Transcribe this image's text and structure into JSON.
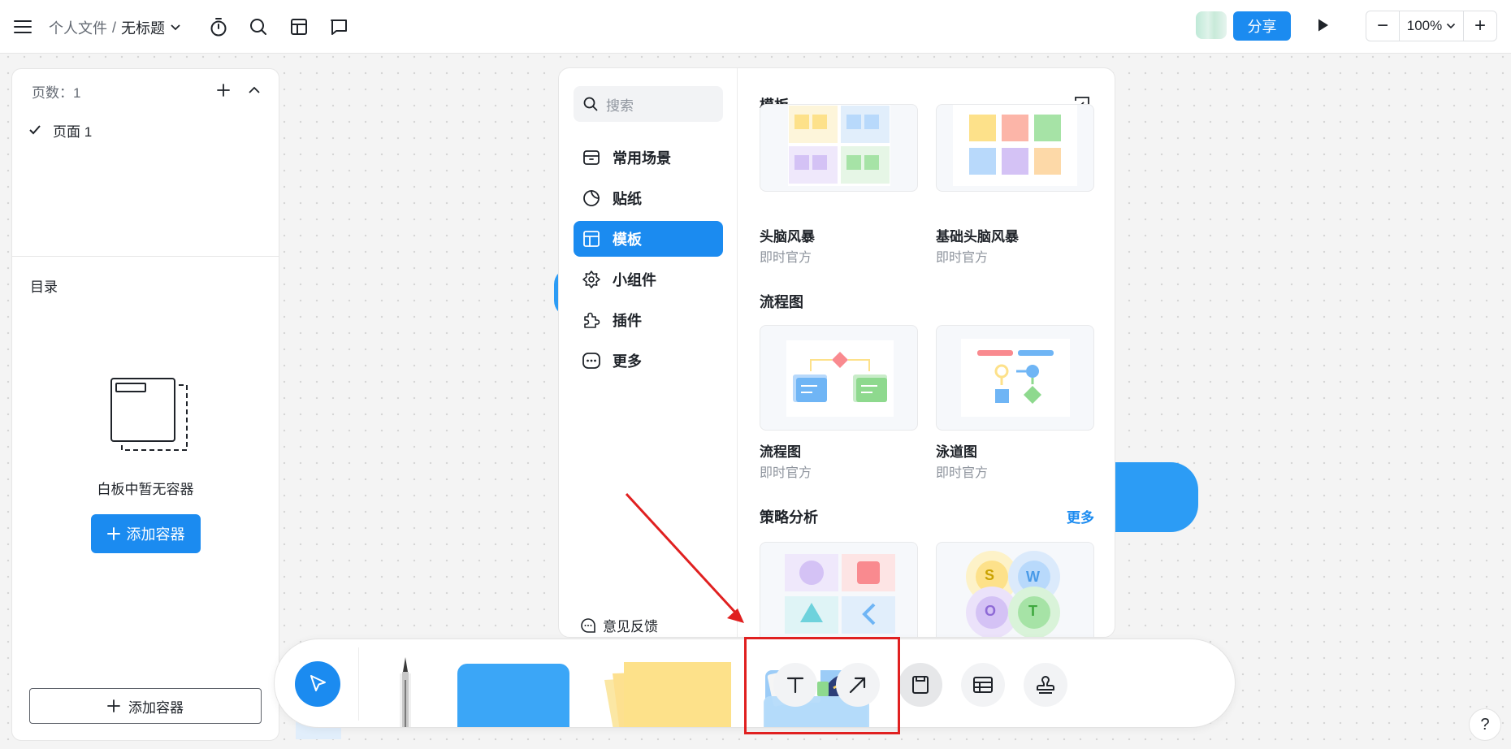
{
  "topbar": {
    "breadcrumb_parent": "个人文件",
    "breadcrumb_sep": "/",
    "breadcrumb_current": "无标题",
    "share_label": "分享",
    "zoom_value": "100%",
    "zoom_minus": "−",
    "zoom_plus": "+"
  },
  "left_panel": {
    "pages_label": "页数：1",
    "pages": [
      {
        "label": "页面 1",
        "selected": true
      }
    ],
    "toc_title": "目录",
    "empty_text": "白板中暂无容器",
    "add_container_primary": "添加容器",
    "add_container_outline": "添加容器"
  },
  "resource_panel": {
    "search_placeholder": "搜索",
    "nav": [
      {
        "label": "常用场景",
        "icon": "box-icon",
        "active": false
      },
      {
        "label": "贴纸",
        "icon": "sticker-icon",
        "active": false
      },
      {
        "label": "模板",
        "icon": "template-icon",
        "active": true
      },
      {
        "label": "小组件",
        "icon": "widget-icon",
        "active": false
      },
      {
        "label": "插件",
        "icon": "plugin-icon",
        "active": false
      },
      {
        "label": "更多",
        "icon": "more-icon",
        "active": false
      }
    ],
    "feedback_label": "意见反馈",
    "main_title": "模板",
    "sections": [
      {
        "title": "",
        "cards": [
          {
            "name": "头脑风暴",
            "source": "即时官方"
          },
          {
            "name": "基础头脑风暴",
            "source": "即时官方"
          }
        ]
      },
      {
        "title": "流程图",
        "cards": [
          {
            "name": "流程图",
            "source": "即时官方"
          },
          {
            "name": "泳道图",
            "source": "即时官方"
          }
        ]
      },
      {
        "title": "策略分析",
        "more_label": "更多",
        "cards": [
          {
            "name": "",
            "source": ""
          },
          {
            "name": "",
            "source": ""
          }
        ]
      }
    ],
    "swot_letters": [
      "S",
      "W",
      "O",
      "T"
    ]
  },
  "toolbar": {
    "tools": [
      "select-tool",
      "pen-tool",
      "shape-tool",
      "sticky-note-tool",
      "resource-library-tool",
      "text-tool",
      "arrow-tool",
      "container-tool",
      "table-tool",
      "stamp-tool"
    ]
  },
  "help_label": "?",
  "colors": {
    "accent": "#1b8bf0",
    "canvas_blue": "#2c9cf5",
    "highlight_red": "#e02020",
    "sticky_yellow": "#fde18a"
  }
}
